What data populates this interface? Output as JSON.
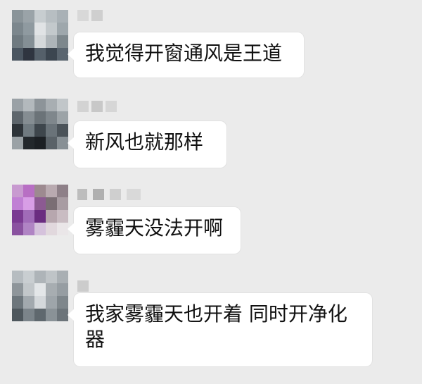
{
  "messages": [
    {
      "text": "我觉得开窗通风是王道"
    },
    {
      "text": "新风也就那样"
    },
    {
      "text": "雾霾天没法开啊"
    },
    {
      "text": "我家雾霾天也开着 同时开净化器"
    }
  ],
  "colors": {
    "background": "#ebebeb",
    "bubble": "#ffffff",
    "text": "#111111"
  }
}
